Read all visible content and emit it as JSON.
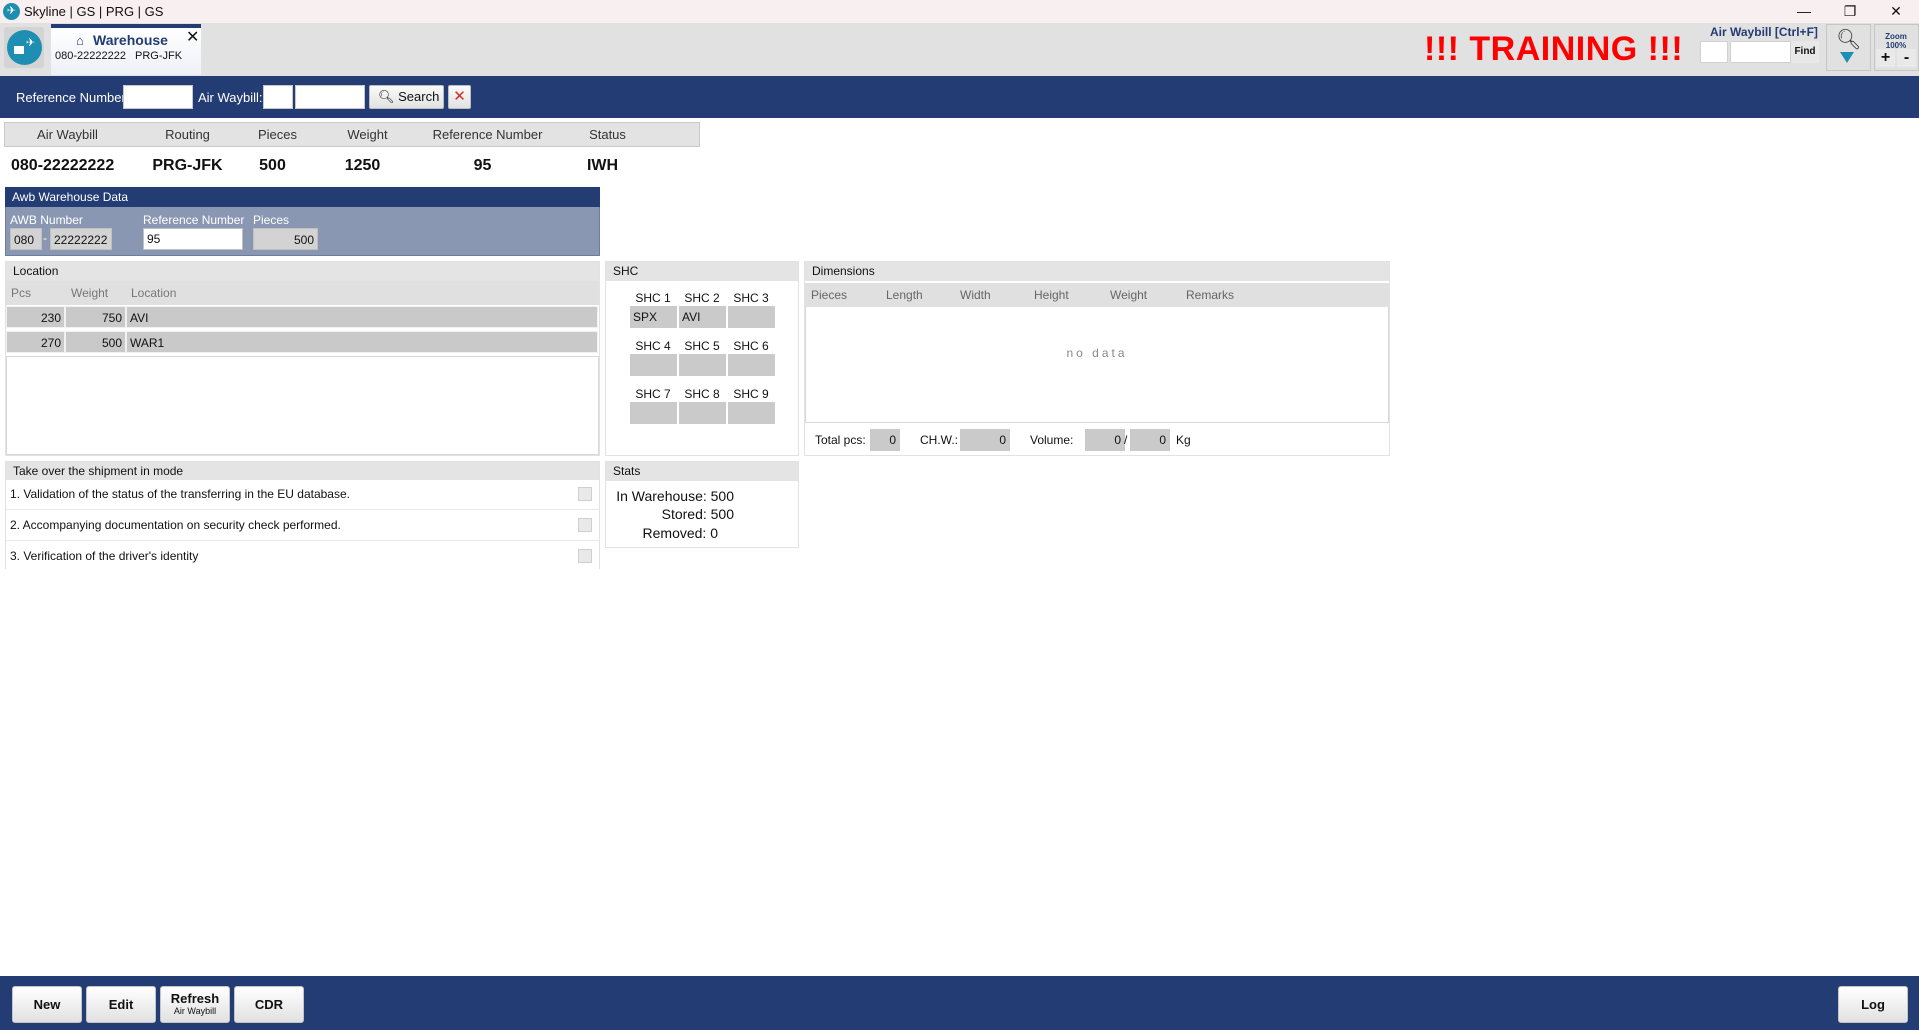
{
  "window": {
    "title": "Skyline | GS | PRG | GS",
    "controls": {
      "minimize": "—",
      "maximize": "❐",
      "close": "✕"
    }
  },
  "tab": {
    "icon": "warehouse-icon",
    "title": "Warehouse",
    "awb": "080-22222222",
    "routing": "PRG-JFK",
    "close": "✕"
  },
  "banner": "!!! TRAINING !!!",
  "quick_find": {
    "label": "Air Waybill [Ctrl+F]",
    "prefix_value": "",
    "number_value": "",
    "find_label": "Find",
    "zoom_label": "Zoom",
    "zoom_value": "100%",
    "zoom_in": "+",
    "zoom_out": "-"
  },
  "search_bar": {
    "reference_label": "Reference Number:",
    "reference_value": "",
    "awb_label": "Air Waybill:",
    "awb_prefix_value": "",
    "awb_number_value": "",
    "search_label": "Search",
    "clear_icon": "✕"
  },
  "summary": {
    "headers": [
      "Air Waybill",
      "Routing",
      "Pieces",
      "Weight",
      "Reference Number",
      "Status"
    ],
    "values": [
      "080-22222222",
      "PRG-JFK",
      "500",
      "1250",
      "95",
      "IWH"
    ]
  },
  "awb_warehouse": {
    "title": "Awb Warehouse Data",
    "awb_label": "AWB Number",
    "awb_prefix": "080",
    "awb_sep": "-",
    "awb_number": "22222222",
    "reference_label": "Reference Number",
    "reference_value": "95",
    "pieces_label": "Pieces",
    "pieces_value": "500"
  },
  "location": {
    "title": "Location",
    "columns": [
      "Pcs",
      "Weight",
      "Location"
    ],
    "rows": [
      {
        "pcs": "230",
        "weight": "750",
        "location": "AVI"
      },
      {
        "pcs": "270",
        "weight": "500",
        "location": "WAR1"
      }
    ]
  },
  "shc": {
    "title": "SHC",
    "codes": [
      {
        "label": "SHC 1",
        "value": "SPX"
      },
      {
        "label": "SHC 2",
        "value": "AVI"
      },
      {
        "label": "SHC 3",
        "value": ""
      },
      {
        "label": "SHC 4",
        "value": ""
      },
      {
        "label": "SHC 5",
        "value": ""
      },
      {
        "label": "SHC 6",
        "value": ""
      },
      {
        "label": "SHC 7",
        "value": ""
      },
      {
        "label": "SHC 8",
        "value": ""
      },
      {
        "label": "SHC 9",
        "value": ""
      }
    ]
  },
  "dimensions": {
    "title": "Dimensions",
    "columns": [
      "Pieces",
      "Length",
      "Width",
      "Height",
      "Weight",
      "Remarks"
    ],
    "empty_text": "no data",
    "total_pcs_label": "Total pcs:",
    "total_pcs": "0",
    "chw_label": "CH.W.:",
    "chw": "0",
    "volume_label": "Volume:",
    "volume_a": "0",
    "volume_sep": "/",
    "volume_b": "0",
    "unit": "Kg"
  },
  "take_over": {
    "title": "Take over the shipment in mode",
    "items": [
      {
        "text": "1. Validation of the status of the transferring in the EU database.",
        "checked": false
      },
      {
        "text": "2. Accompanying documentation on security check performed.",
        "checked": false
      },
      {
        "text": "3. Verification of the driver's identity",
        "checked": false
      }
    ]
  },
  "stats": {
    "title": "Stats",
    "in_warehouse": "In Warehouse: 500",
    "stored": "Stored: 500",
    "removed": "Removed: 0"
  },
  "footer": {
    "new": "New",
    "edit": "Edit",
    "refresh": "Refresh",
    "refresh_sub": "Air Waybill",
    "cdr": "CDR",
    "log": "Log"
  },
  "colors": {
    "brand_navy": "#233c74",
    "training_red": "#ff0000",
    "logo_teal": "#1e8fb3"
  }
}
